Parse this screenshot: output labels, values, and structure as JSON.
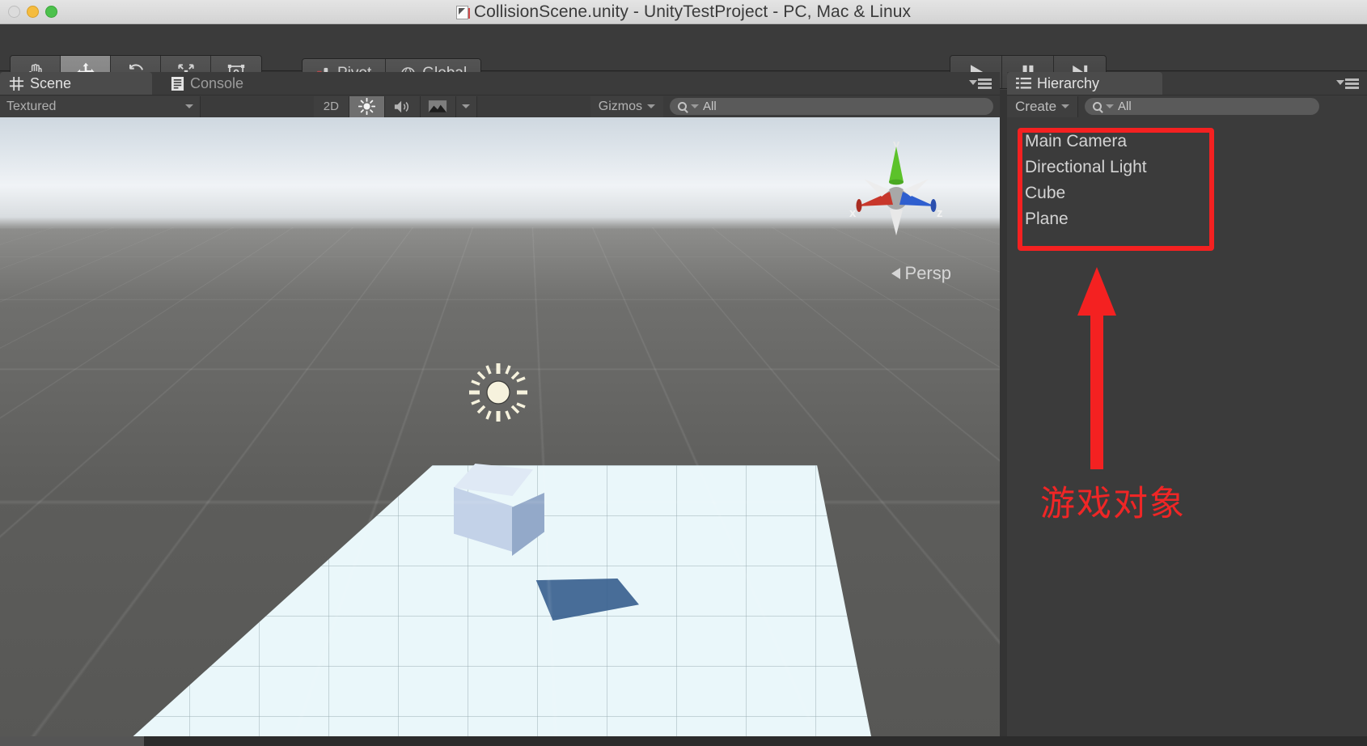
{
  "window": {
    "title": "CollisionScene.unity - UnityTestProject - PC, Mac & Linux",
    "doc_icon": "unity-document-icon",
    "close_label": "",
    "minimize_label": "",
    "maximize_label": ""
  },
  "toolbar": {
    "transform_tools": [
      {
        "name": "hand-tool",
        "label": "Hand",
        "active": false
      },
      {
        "name": "move-tool",
        "label": "Move",
        "active": true
      },
      {
        "name": "rotate-tool",
        "label": "Rotate",
        "active": false
      },
      {
        "name": "scale-tool",
        "label": "Scale",
        "active": false
      },
      {
        "name": "rect-tool",
        "label": "Rect",
        "active": false
      }
    ],
    "pivot_label": "Pivot",
    "global_label": "Global",
    "play_label": "Play",
    "pause_label": "Pause",
    "step_label": "Step"
  },
  "scene_panel": {
    "tabs": [
      {
        "label": "Scene",
        "icon": "grid-icon",
        "active": true
      },
      {
        "label": "Console",
        "icon": "console-icon",
        "active": false
      }
    ],
    "draw_mode": "Textured",
    "two_d_label": "2D",
    "lighting_label": "lighting-toggle",
    "audio_label": "audio-toggle",
    "effects_label": "effects-toggle",
    "gizmos_label": "Gizmos",
    "search_value": "All",
    "search_placeholder": "All",
    "view_mode": "Persp",
    "axis_x": "x",
    "axis_y": "y",
    "axis_z": "z"
  },
  "hierarchy_panel": {
    "tab_label": "Hierarchy",
    "tab_icon": "hierarchy-list-icon",
    "create_label": "Create",
    "search_value": "All",
    "search_placeholder": "All",
    "items": [
      {
        "label": "Main Camera"
      },
      {
        "label": "Directional Light"
      },
      {
        "label": "Cube"
      },
      {
        "label": "Plane"
      }
    ]
  },
  "annotation": {
    "text": "游戏对象",
    "color": "#ef2626",
    "box_color": "#f42121"
  },
  "colors": {
    "accent_red": "#ef2626",
    "panel_bg": "#3b3b3b",
    "toolbar_bg": "#3b3b3b",
    "titlebar_bg": "#d9d9d9",
    "axis_x": "#c8372b",
    "axis_y": "#5cc22a",
    "axis_z": "#2f5fcf"
  }
}
